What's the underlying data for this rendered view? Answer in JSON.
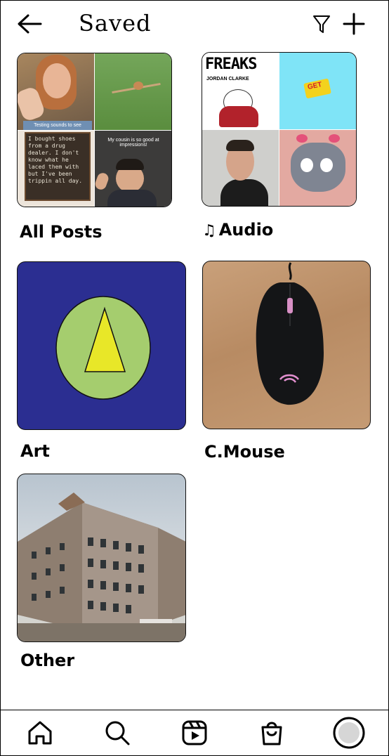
{
  "header": {
    "title": "Saved"
  },
  "collections": [
    {
      "label": "All Posts"
    },
    {
      "label": "Audio"
    },
    {
      "label": "Art"
    },
    {
      "label": "C.Mouse"
    },
    {
      "label": "Other"
    }
  ],
  "all_posts_thumbs": {
    "caption1": "Testing sounds to see",
    "chalk_text": "I bought shoes from a drug dealer. I don't know what he laced them with but I've been trippin all day.",
    "caption2": "My cousin is so good at impressions!"
  },
  "audio_thumbs": {
    "album_title": "FREAKS",
    "album_artist": "JORDAN CLARKE",
    "sticker_text": "GET"
  },
  "bottom_nav": [
    "home",
    "search",
    "reels",
    "shop",
    "profile"
  ]
}
